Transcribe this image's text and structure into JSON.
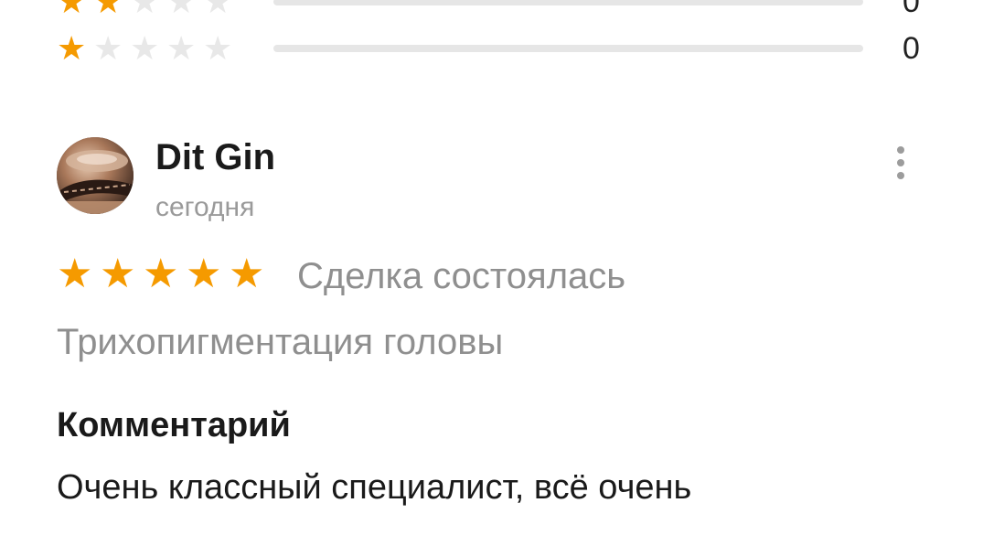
{
  "rating_distribution": [
    {
      "stars": 2,
      "count": "0",
      "fraction": 0
    },
    {
      "stars": 1,
      "count": "0",
      "fraction": 0
    }
  ],
  "review": {
    "author_name": "Dit Gin",
    "date": "сегодня",
    "rating": 5,
    "deal_status": "Сделка состоялась",
    "service": "Трихопигментация головы",
    "comment_heading": "Комментарий",
    "comment_text": "Очень классный специалист, всё очень"
  },
  "colors": {
    "star_active": "#f59a00",
    "star_inactive": "#e8e8e8",
    "secondary_text": "#8f8f8f"
  },
  "icons": {
    "more": "more-vertical-icon",
    "star": "star-icon"
  }
}
